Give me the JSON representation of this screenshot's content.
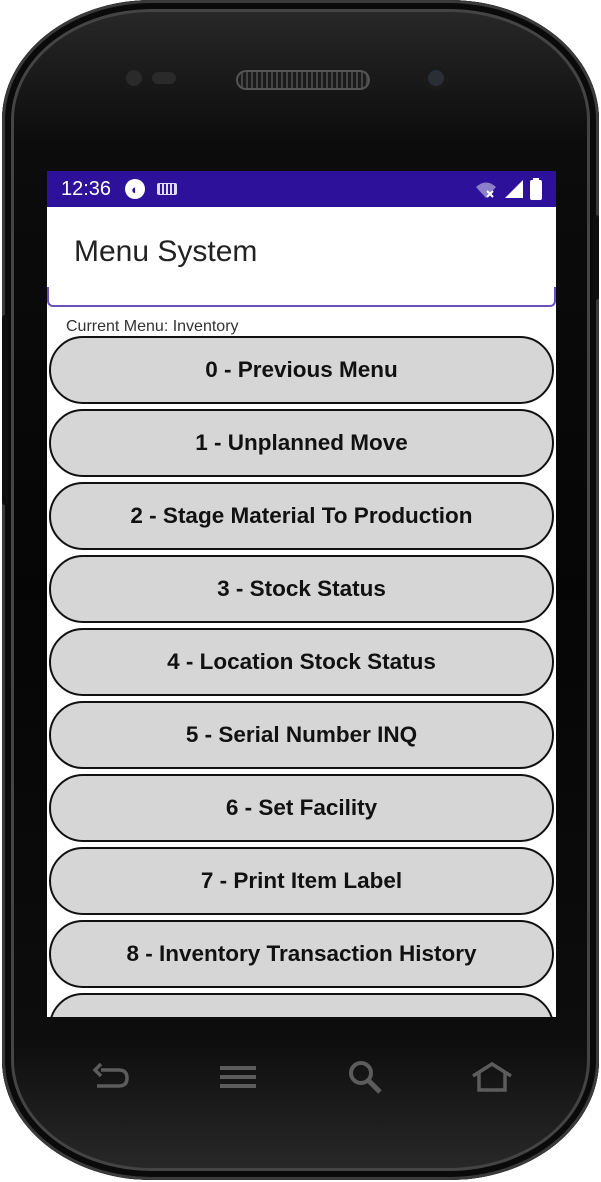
{
  "status_bar": {
    "time": "12:36",
    "app_icon": "app-notification-icon",
    "keyboard_icon": "keyboard-icon",
    "wifi_icon": "wifi-off-icon",
    "signal_icon": "signal-icon",
    "battery_icon": "battery-icon",
    "color": "#2d119b"
  },
  "toolbar": {
    "title": "Menu System",
    "accent": "#6a4fc1"
  },
  "current_menu": "Current Menu: Inventory",
  "menu_items": [
    "0 - Previous Menu",
    "1 - Unplanned Move",
    "2 - Stage Material To Production",
    "3 - Stock Status",
    "4 - Location Stock Status",
    "5 - Serial Number INQ",
    "6 - Set Facility",
    "7 - Print Item Label",
    "8 - Inventory Transaction History",
    ""
  ],
  "nav": [
    "back-icon",
    "menu-icon",
    "search-icon",
    "home-icon"
  ],
  "button_fill": "#d6d6d6"
}
